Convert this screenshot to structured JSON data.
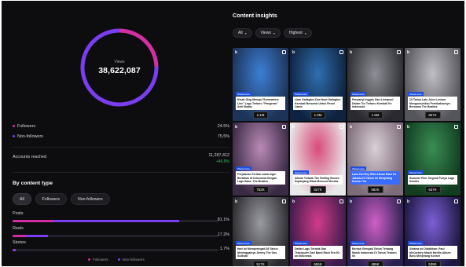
{
  "summary": {
    "views_label": "Views",
    "views_value": "38,622,087",
    "followers_pct": 24.5,
    "nonfollowers_pct": 75.5
  },
  "audience": {
    "followers_label": "Followers",
    "followers_value": "24.5%",
    "nonfollowers_label": "Non-followers",
    "nonfollowers_value": "75.5%"
  },
  "reach": {
    "label": "Accounts reached",
    "value": "11,287,412",
    "delta": "+40.9%"
  },
  "by_content": {
    "title": "By content type",
    "filters": [
      "All",
      "Followers",
      "Non-followers"
    ],
    "rows": [
      {
        "label": "Posts",
        "value": "81.1%",
        "followers_frac": 0.2,
        "total_frac": 0.811
      },
      {
        "label": "Reels",
        "value": "17.2%",
        "followers_frac": 0.065,
        "total_frac": 0.172
      },
      {
        "label": "Stories",
        "value": "1.7%",
        "followers_frac": 0.006,
        "total_frac": 0.017
      }
    ],
    "legend_followers": "Followers",
    "legend_nonfollowers": "Non-followers"
  },
  "colors": {
    "followers": "#d22fa2",
    "nonfollowers": "#7a3ef0",
    "positive": "#34c759",
    "background": "#0d0d10"
  },
  "insights": {
    "title": "Content insights",
    "filters": [
      "All",
      "Views",
      "Highest"
    ],
    "posts": [
      {
        "headline": "Kisah Oleg Menuju\"Somewhere Like\" Lagu Terbaru \"Pangeran\" Arbi Skatta",
        "views": "2.1M",
        "tag": "Wawancara",
        "c1": "#3c7fd6",
        "c2": "#1d3357",
        "hl": "#ffffff"
      },
      {
        "headline": "Liam Gallagher Dan Noel Gallagher Kembali Bersama Untuk Reuni Oasis",
        "views": "1.9M",
        "tag": "Wawancara",
        "c1": "#2f6fb0",
        "c2": "#0f2340",
        "hl": "#ffffff"
      },
      {
        "headline": "Penyanyi Inggris Dari Liverpool Dalam Tur Terbaru Kembali Ke Indonesia",
        "views": "1.8M",
        "tag": "Wawancara",
        "c1": "#8e8e96",
        "c2": "#2a2a30",
        "hl": "#ffffff"
      },
      {
        "headline": "15 Tahun Lalu John Lennon Mengumumkan Pernikahannya Bersama The Beatles",
        "views": "857K",
        "tag": "Wawancara",
        "c1": "#bfbfc4",
        "c2": "#55555c",
        "hl": "#ffffff"
      },
      {
        "headline": "Perjalanan Terlalu Lama Ingin Bertahan di Indonesia Dengan Lagu Baru: The Beatles",
        "views": "782K",
        "tag": "Wawancara",
        "c1": "#b98ab6",
        "c2": "#3b2a45",
        "hl": "#ffffff"
      },
      {
        "headline": "Album Terbaik The Rolling Stones Sepanjang Masa Menurut Mereka",
        "views": "827K",
        "tag": "Wawancara",
        "c1": "#d94a7a",
        "c2": "#e8e8ea",
        "hl": "#ffffff"
      },
      {
        "headline": "Lana Del Rey Rilis Album Baru Ke Jakarta Di Tahun Ini Menjelang Konser Tur",
        "views": "582K",
        "tag": "Wawancara",
        "c1": "#d9cfd6",
        "c2": "#7e6c7a",
        "hl": "#3a6cff"
      },
      {
        "headline": "Summer Finn Tergesa Punya Lagu Sendiri",
        "views": "537K",
        "tag": "Wawancara",
        "c1": "#3a8d54",
        "c2": "#123d22",
        "hl": "#ffffff"
      },
      {
        "headline": "Hari Ini Memperingati 38 Tahun Meninggalnya Jimmy The Doo Sullivan",
        "views": "517K",
        "tag": "Wawancara",
        "c1": "#9a9aa2",
        "c2": "#2a2a2e",
        "hl": "#ffffff"
      },
      {
        "headline": "Daftar Lagu Terbaik Dan Terpopuler Dari Band Rock Era 90-an Indonesia",
        "views": "655K",
        "tag": "Wawancara",
        "c1": "#d23b8a",
        "c2": "#3c1b4a",
        "hl": "#ffffff"
      },
      {
        "headline": "Berkah Gempak Tahun Tentang Musik Indonesia Di Tahun Terbaru Ini",
        "views": "495K",
        "tag": "Wawancara",
        "c1": "#cf5fc7",
        "c2": "#2a2150",
        "hl": "#ffffff"
      },
      {
        "headline": "Selama Ini Dilatihkan: Paul McCartney Masih Merilis Album Baru Menjelang Konser",
        "views": "538K",
        "tag": "Wawancara",
        "c1": "#7b5fd6",
        "c2": "#1d1740",
        "hl": "#ffffff"
      }
    ]
  }
}
